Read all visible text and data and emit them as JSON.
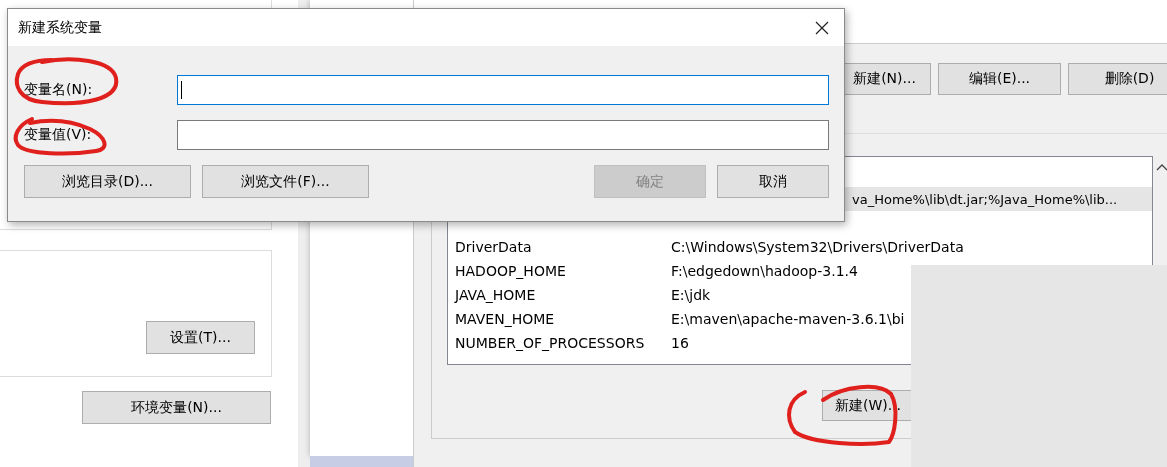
{
  "system_properties": {
    "buttons": [
      "设置(T)...",
      "环境变量(N)..."
    ]
  },
  "environment_variables": {
    "user_buttons": [
      "新建(N)...",
      "编辑(E)...",
      "删除(D)"
    ],
    "system_variables": {
      "rows": [
        {
          "value": "va_Home%\\lib\\dt.jar;%Java_Home%\\lib...",
          "selected": true
        },
        {
          "name": "DriverData",
          "value": "C:\\Windows\\System32\\Drivers\\DriverData",
          "selected": false
        },
        {
          "name": "HADOOP_HOME",
          "value": "F:\\edgedown\\hadoop-3.1.4",
          "selected": false
        },
        {
          "name": "JAVA_HOME",
          "value": "E:\\jdk",
          "selected": false
        },
        {
          "name": "MAVEN_HOME",
          "value": "E:\\maven\\apache-maven-3.6.1\\bi",
          "selected": false
        },
        {
          "name": "NUMBER_OF_PROCESSORS",
          "value": "16",
          "selected": false
        }
      ],
      "buttons": [
        "新建(W)..."
      ]
    }
  },
  "dialog": {
    "title": "新建系统变量",
    "fields": [
      {
        "label": "变量名(N):",
        "focused": true
      },
      {
        "label": "变量值(V):",
        "focused": false
      }
    ],
    "browse_buttons": [
      {
        "label": "浏览目录(D)...",
        "disabled": false
      },
      {
        "label": "浏览文件(F)...",
        "disabled": false
      }
    ],
    "action_buttons": [
      {
        "label": "确定",
        "disabled": true
      },
      {
        "label": "取消",
        "disabled": false
      }
    ]
  },
  "annotations": [
    {
      "kind": "circle"
    },
    {
      "kind": "circle"
    },
    {
      "kind": "circle"
    }
  ]
}
